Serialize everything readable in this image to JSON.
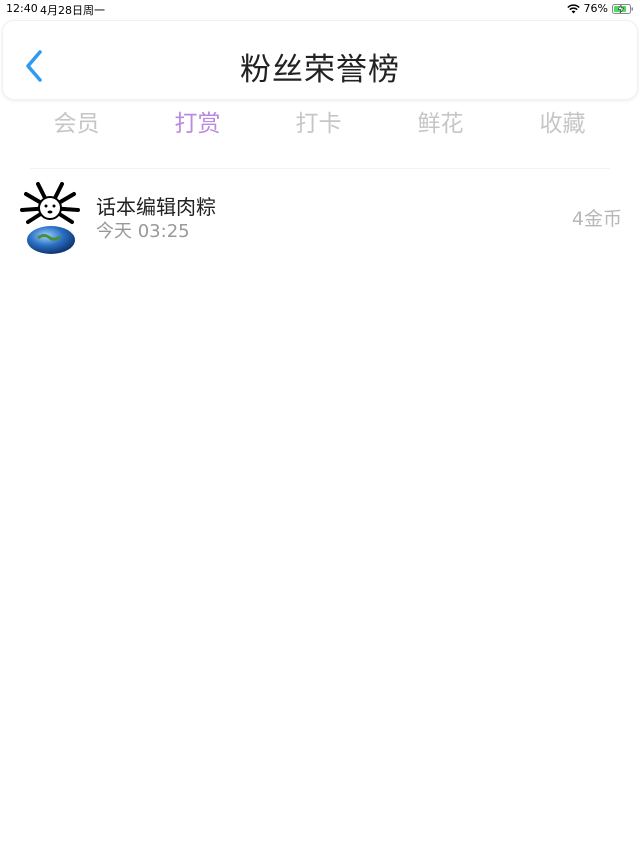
{
  "status_bar": {
    "time": "12:40",
    "date": "4月28日周一",
    "battery": "76%"
  },
  "header": {
    "title": "粉丝荣誉榜"
  },
  "tabs": [
    {
      "label": "会员",
      "active": false
    },
    {
      "label": "打赏",
      "active": true
    },
    {
      "label": "打卡",
      "active": false
    },
    {
      "label": "鲜花",
      "active": false
    },
    {
      "label": "收藏",
      "active": false
    }
  ],
  "list": [
    {
      "name": "话本编辑肉粽",
      "time": "今天 03:25",
      "amount": "4金币",
      "avatar_icon": "earth-meme-avatar-icon"
    }
  ],
  "colors": {
    "accent": "#b98ae3",
    "back_arrow": "#2f9bf0",
    "tab_inactive": "#c6c6c6"
  }
}
